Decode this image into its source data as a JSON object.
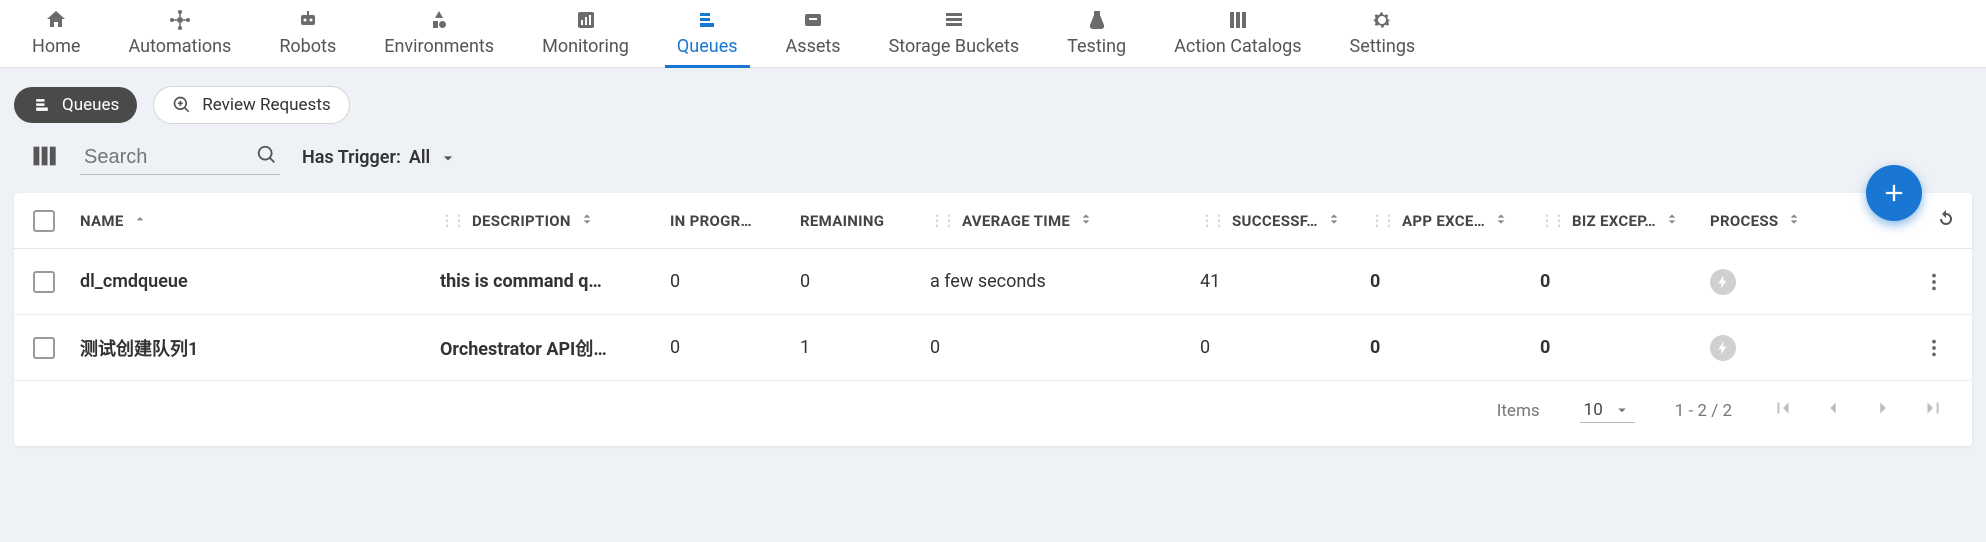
{
  "nav": {
    "tabs": [
      {
        "label": "Home",
        "icon": "home",
        "active": false
      },
      {
        "label": "Automations",
        "icon": "automations",
        "active": false
      },
      {
        "label": "Robots",
        "icon": "robot",
        "active": false
      },
      {
        "label": "Environments",
        "icon": "environments",
        "active": false
      },
      {
        "label": "Monitoring",
        "icon": "monitoring",
        "active": false
      },
      {
        "label": "Queues",
        "icon": "queues",
        "active": true
      },
      {
        "label": "Assets",
        "icon": "assets",
        "active": false
      },
      {
        "label": "Storage Buckets",
        "icon": "buckets",
        "active": false
      },
      {
        "label": "Testing",
        "icon": "testing",
        "active": false
      },
      {
        "label": "Action Catalogs",
        "icon": "catalogs",
        "active": false
      },
      {
        "label": "Settings",
        "icon": "settings",
        "active": false
      }
    ]
  },
  "secondary": {
    "queues_chip": "Queues",
    "review_chip": "Review Requests"
  },
  "filters": {
    "search_placeholder": "Search",
    "has_trigger_label": "Has Trigger:",
    "has_trigger_value": "All"
  },
  "table": {
    "columns": {
      "name": "NAME",
      "description": "DESCRIPTION",
      "in_progress": "IN PROGR…",
      "remaining": "REMAINING",
      "avg_time": "AVERAGE TIME",
      "successful": "SUCCESSF…",
      "app_exc": "APP EXCE…",
      "biz_exc": "BIZ EXCEP…",
      "process": "PROCESS"
    },
    "rows": [
      {
        "name": "dl_cmdqueue",
        "description": "this is command q…",
        "in_progress": "0",
        "remaining": "0",
        "avg_time": "a few seconds",
        "successful": "41",
        "app_exc": "0",
        "biz_exc": "0"
      },
      {
        "name": "测试创建队列1",
        "description": "Orchestrator API创…",
        "in_progress": "0",
        "remaining": "1",
        "avg_time": "0",
        "successful": "0",
        "app_exc": "0",
        "biz_exc": "0"
      }
    ]
  },
  "pager": {
    "items_label": "Items",
    "page_size": "10",
    "range": "1 - 2 / 2"
  }
}
